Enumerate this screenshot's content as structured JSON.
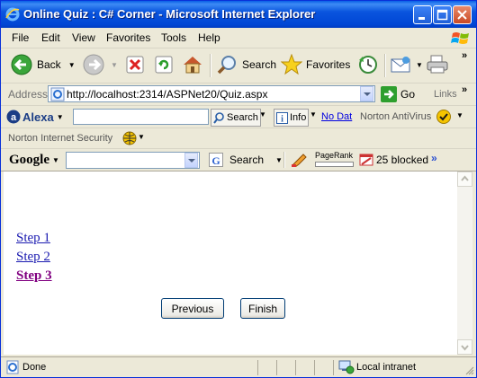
{
  "window": {
    "title": "Online Quiz : C# Corner - Microsoft Internet Explorer"
  },
  "menu": [
    "File",
    "Edit",
    "View",
    "Favorites",
    "Tools",
    "Help"
  ],
  "toolbar": {
    "back_label": "Back",
    "search_label": "Search",
    "favorites_label": "Favorites"
  },
  "address": {
    "label": "Address",
    "url": "http://localhost:2314/ASPNet20/Quiz.aspx",
    "go_label": "Go",
    "links_label": "Links"
  },
  "alexa": {
    "brand": "Alexa",
    "search_label": "Search",
    "info_label": "Info",
    "no_dat_label": "No Dat",
    "norton_antivirus_label": "Norton AntiVirus"
  },
  "norton": {
    "security_label": "Norton Internet Security"
  },
  "google": {
    "brand": "Google",
    "search_label": "Search",
    "pagerank_label": "PageRank",
    "blocked_label": "25 blocked"
  },
  "quiz": {
    "steps": [
      "Step 1",
      "Step 2",
      "Step 3"
    ],
    "current_step": "Step 3",
    "previous_label": "Previous",
    "finish_label": "Finish"
  },
  "status": {
    "text": "Done",
    "zone": "Local intranet"
  },
  "colors": {
    "title_bar": "#0054e3",
    "link": "#1a1ab0",
    "visited_link": "#800080",
    "chrome": "#ece9d8"
  }
}
